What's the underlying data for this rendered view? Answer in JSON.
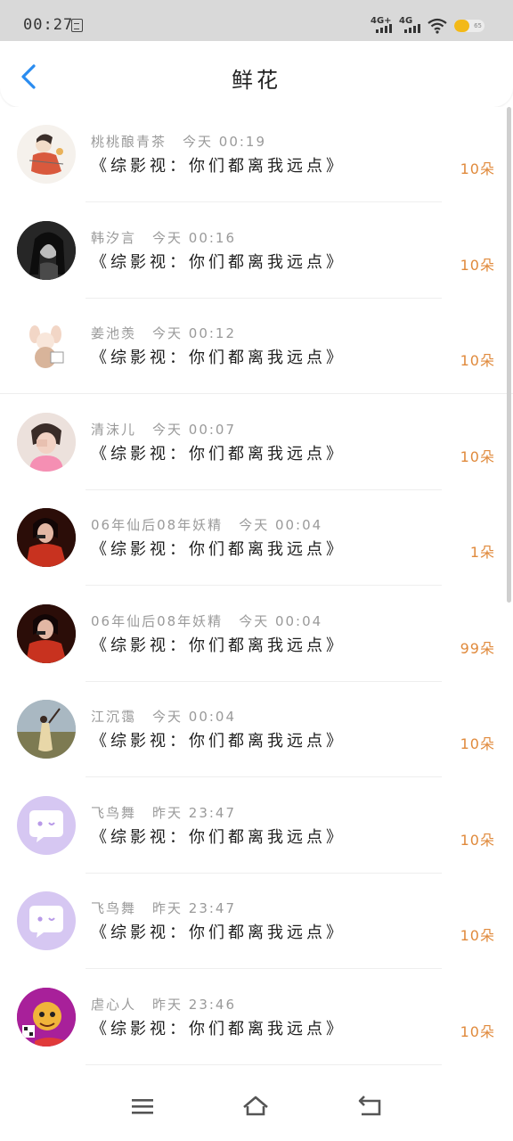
{
  "status": {
    "time": "00:27",
    "network1": "4G+",
    "network2": "4G",
    "battery": "65"
  },
  "header": {
    "title": "鲜花"
  },
  "colors": {
    "accent": "#2a8cf0",
    "count": "#e08a3c"
  },
  "items": [
    {
      "name": "桃桃酿青茶",
      "time": "今天 00:19",
      "desc": "《综影视：你们都离我远点》",
      "count": "10朵",
      "avatar": "girl-illustration"
    },
    {
      "name": "韩汐言",
      "time": "今天 00:16",
      "desc": "《综影视：你们都离我远点》",
      "count": "10朵",
      "avatar": "dark-photo"
    },
    {
      "name": "姜池羡",
      "time": "今天 00:12",
      "desc": "《综影视：你们都离我远点》",
      "count": "10朵",
      "avatar": "bunny-illustration"
    },
    {
      "name": "清沫儿",
      "time": "今天 00:07",
      "desc": "《综影视：你们都离我远点》",
      "count": "10朵",
      "avatar": "pink-photo"
    },
    {
      "name": "06年仙后08年妖精",
      "time": "今天 00:04",
      "desc": "《综影视：你们都离我远点》",
      "count": "1朵",
      "avatar": "red-singer-photo"
    },
    {
      "name": "06年仙后08年妖精",
      "time": "今天 00:04",
      "desc": "《综影视：你们都离我远点》",
      "count": "99朵",
      "avatar": "red-singer-photo"
    },
    {
      "name": "江沉霭",
      "time": "今天 00:04",
      "desc": "《综影视：你们都离我远点》",
      "count": "10朵",
      "avatar": "field-photo"
    },
    {
      "name": "飞鸟舞",
      "time": "昨天 23:47",
      "desc": "《综影视：你们都离我远点》",
      "count": "10朵",
      "avatar": "chat-bubble-icon"
    },
    {
      "name": "飞鸟舞",
      "time": "昨天 23:47",
      "desc": "《综影视：你们都离我远点》",
      "count": "10朵",
      "avatar": "chat-bubble-icon"
    },
    {
      "name": "虐心人",
      "time": "昨天 23:46",
      "desc": "《综影视：你们都离我远点》",
      "count": "10朵",
      "avatar": "tiger-sticker"
    }
  ],
  "navbar": {
    "icons": [
      "menu-icon",
      "home-icon",
      "back-icon"
    ]
  }
}
